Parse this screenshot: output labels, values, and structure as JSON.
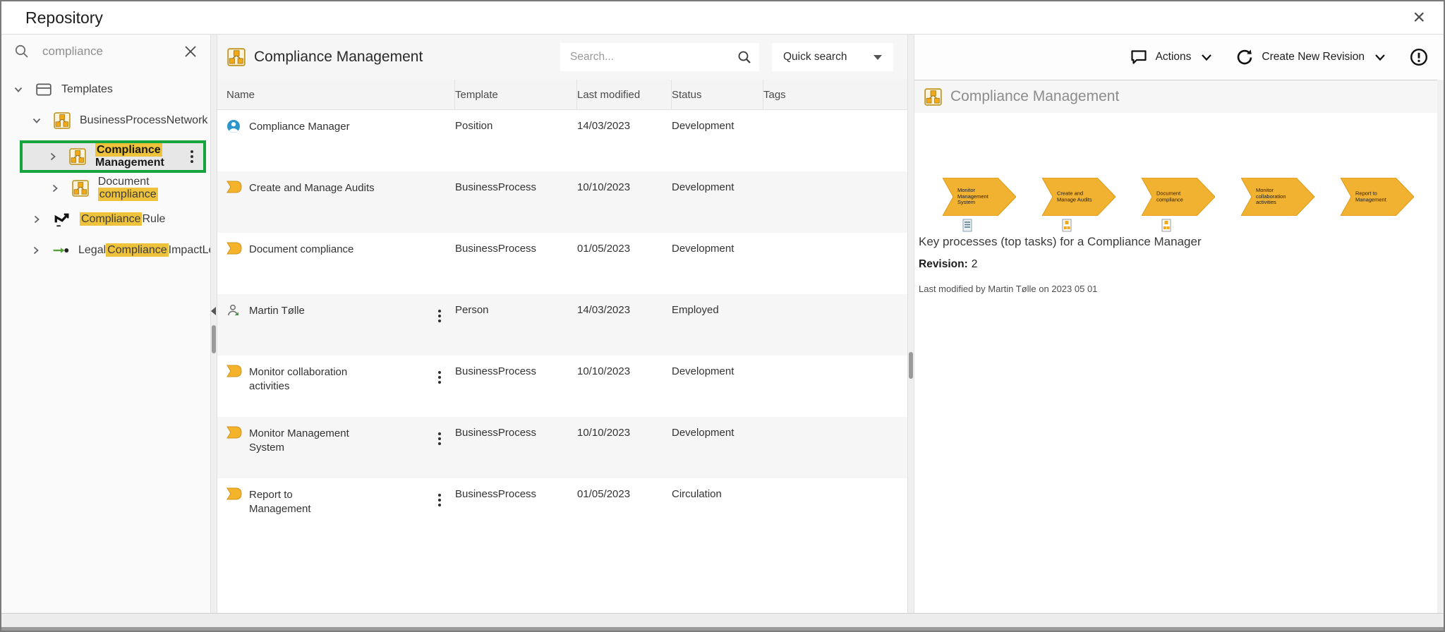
{
  "window": {
    "title": "Repository",
    "close_glyph": "×"
  },
  "colors": {
    "selection_green": "#16A43C",
    "match_highlight_yellow": "#EFC23B",
    "process_arrow_yellow": "#F2B231",
    "icon_yellow": "#F2A918",
    "position_icon_blue": "#2C95CC"
  },
  "left_panel": {
    "search": {
      "value": "compliance"
    },
    "tree": {
      "templates": {
        "label": "Templates"
      },
      "bpn": {
        "label": "BusinessProcessNetwork"
      },
      "compliance_management": {
        "hl": "Compliance",
        "post": " Management"
      },
      "document_compliance": {
        "pre": "Document ",
        "hl": "compliance"
      },
      "compliance_rule": {
        "hl": "Compliance",
        "post": "Rule"
      },
      "legal_compliance": {
        "pre": "Legal",
        "hl": "Compliance",
        "post": "ImpactLevel"
      }
    }
  },
  "list_panel": {
    "title": "Compliance Management",
    "search_placeholder": "Search...",
    "quick_search_label": "Quick search",
    "columns": [
      "Name",
      "Template",
      "Last modified",
      "Status",
      "Tags"
    ],
    "rows": [
      {
        "name": "Compliance Manager",
        "template": "Position",
        "modified": "14/03/2023",
        "status": "Development",
        "tags": ""
      },
      {
        "name": "Create and Manage Audits",
        "template": "BusinessProcess",
        "modified": "10/10/2023",
        "status": "Development",
        "tags": ""
      },
      {
        "name": "Document compliance",
        "template": "BusinessProcess",
        "modified": "01/05/2023",
        "status": "Development",
        "tags": ""
      },
      {
        "name": "Martin Tølle",
        "template": "Person",
        "modified": "14/03/2023",
        "status": "Employed",
        "tags": ""
      },
      {
        "name": "Monitor collaboration activities",
        "template": "BusinessProcess",
        "modified": "10/10/2023",
        "status": "Development",
        "tags": ""
      },
      {
        "name": "Monitor Management System",
        "template": "BusinessProcess",
        "modified": "10/10/2023",
        "status": "Development",
        "tags": ""
      },
      {
        "name": "Report to Management",
        "template": "BusinessProcess",
        "modified": "01/05/2023",
        "status": "Circulation",
        "tags": ""
      }
    ]
  },
  "detail_panel": {
    "actions_label": "Actions",
    "create_revision_label": "Create New Revision",
    "title": "Compliance Management",
    "diagram": {
      "shapes": [
        "Monitor Management System",
        "Create and Manage Audits",
        "Document compliance",
        "Monitor collaboration activities",
        "Report to Management"
      ],
      "caption": "Key processes (top tasks) for a Compliance Manager"
    },
    "revision_label": "Revision:",
    "revision_value": "2",
    "last_modified": "Last modified by Martin Tølle on 2023 05 01"
  }
}
